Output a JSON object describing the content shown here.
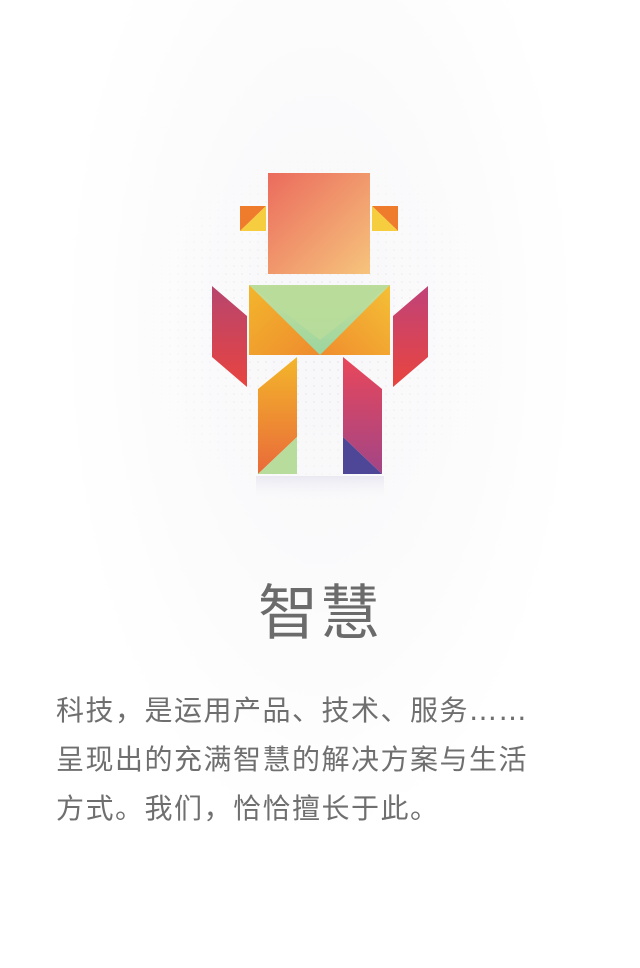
{
  "illustration": {
    "icon": "tangram-robot-icon",
    "colors": {
      "head_start": "#ec6f5c",
      "head_end": "#f6c178",
      "ear_orange": "#f39a2c",
      "ear_yellow": "#f7d34a",
      "arm_red": "#e3434e",
      "arm_purple": "#b0426f",
      "body_green": "#a6d99a",
      "body_yellow": "#f2b927",
      "leg_purple": "#5e4a9a",
      "leg_pink": "#e0466a"
    }
  },
  "content": {
    "title": "智慧",
    "paragraph_lines": [
      "科技，是运用产品、技术、服务……",
      "呈现出的充满智慧的解决方案与生活",
      "方式。我们，恰恰擅长于此。"
    ]
  }
}
